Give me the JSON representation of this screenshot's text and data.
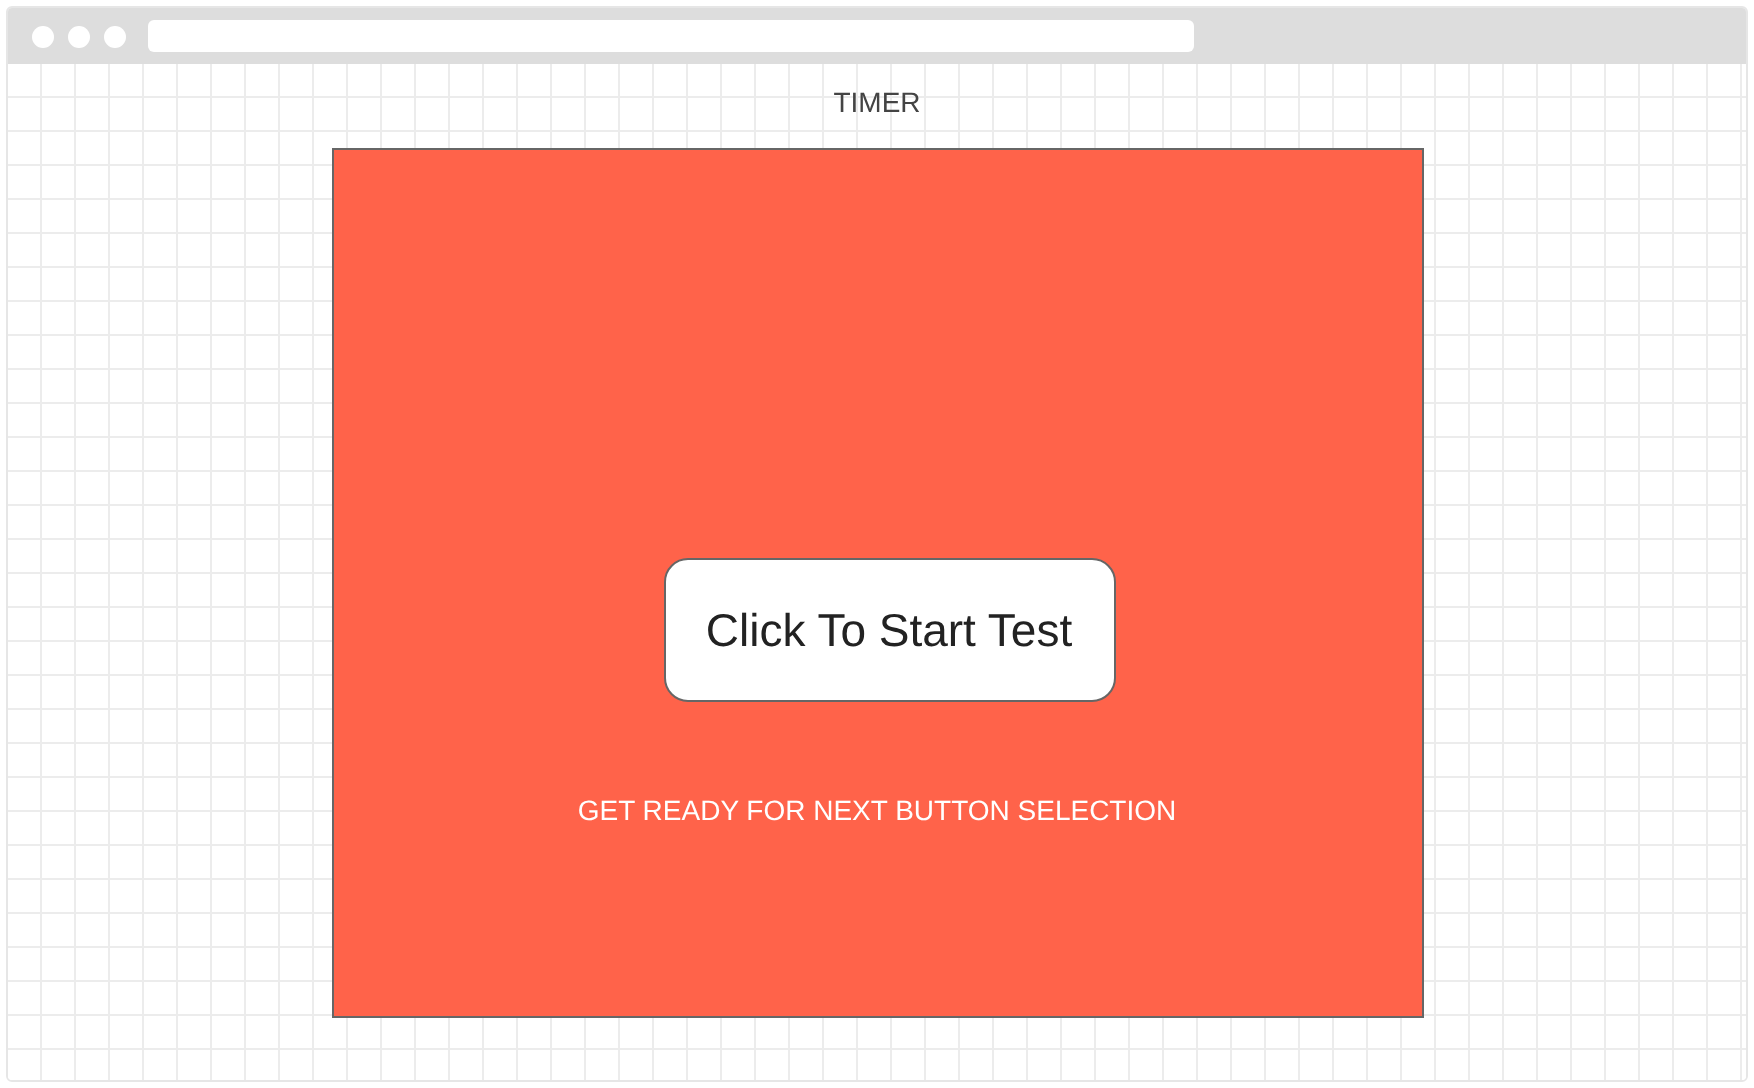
{
  "title": "TIMER",
  "panel": {
    "button": "Click To Start Test",
    "message": "GET READY FOR NEXT BUTTON SELECTION"
  }
}
